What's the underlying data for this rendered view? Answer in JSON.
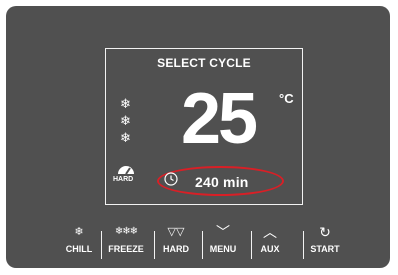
{
  "display": {
    "title": "SELECT CYCLE",
    "temperature": "25",
    "unit": "°C",
    "mode_label": "HARD",
    "timer": "240 min"
  },
  "icons": {
    "snowflake": "snowflake-icon",
    "gauge": "gauge-icon",
    "clock": "clock-icon"
  },
  "buttons": [
    {
      "label": "CHILL",
      "icon": "❄"
    },
    {
      "label": "FREEZE",
      "icon": "❄❄❄"
    },
    {
      "label": "HARD",
      "icon": "▽▽"
    },
    {
      "label": "MENU",
      "icon": "﹀"
    },
    {
      "label": "AUX",
      "icon": "︿"
    },
    {
      "label": "START",
      "icon": "↻"
    }
  ],
  "colors": {
    "panel": "#505050",
    "highlight": "#d91f26",
    "text": "#ffffff"
  }
}
